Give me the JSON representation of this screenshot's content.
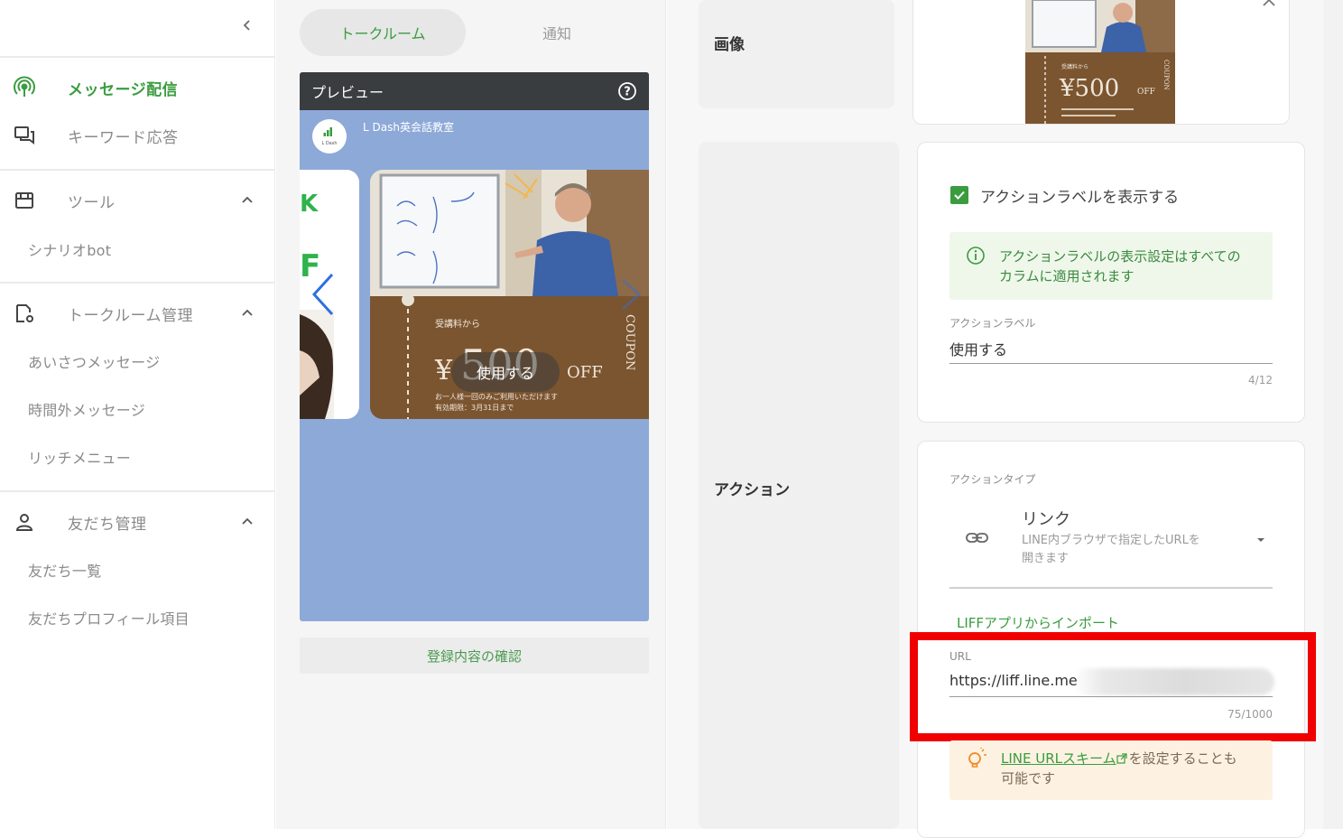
{
  "sidebar": {
    "collapse_icon": "chevron-left-icon",
    "items": [
      {
        "label": "メッセージ配信",
        "icon": "broadcast-icon",
        "active": true
      },
      {
        "label": "キーワード応答",
        "icon": "chat-reply-icon"
      }
    ],
    "tool_section": {
      "label": "ツール",
      "icon": "store-icon",
      "items": [
        "シナリオbot"
      ]
    },
    "talkroom_section": {
      "label": "トークルーム管理",
      "icon": "talkroom-settings-icon",
      "items": [
        "あいさつメッセージ",
        "時間外メッセージ",
        "リッチメニュー"
      ]
    },
    "friends_section": {
      "label": "友だち管理",
      "icon": "person-icon",
      "items": [
        "友だち一覧",
        "友だちプロフィール項目"
      ]
    }
  },
  "middle": {
    "tabs": [
      {
        "label": "トークルーム",
        "active": true
      },
      {
        "label": "通知",
        "active": false
      }
    ],
    "preview": {
      "title": "プレビュー",
      "bot_name": "L Dash英会話教室",
      "avatar_text": "L Dash",
      "left_card_letters": [
        "K",
        "F"
      ],
      "coupon": {
        "prefix": "受講料から",
        "currency": "¥",
        "amount": "500",
        "suffix": "OFF",
        "side_text": "COUPON",
        "note1": "お一人様一回のみご利用いただけます",
        "note2": "有効期限：3月31日まで"
      },
      "action_button": "使用する"
    },
    "confirm_button": "登録内容の確認"
  },
  "right": {
    "image_section": {
      "label": "画像",
      "thumbnail": {
        "prefix": "受講料から",
        "amount": "¥500",
        "suffix": "OFF",
        "side_text": "COUPON"
      }
    },
    "action_section": {
      "label": "アクション",
      "show_label_checkbox": "アクションラベルを表示する",
      "info_text_line1": "アクションラベルの表示設定はすべての",
      "info_text_line2": "カラムに適用されます",
      "action_label_caption": "アクションラベル",
      "action_label_value": "使用する",
      "action_label_counter": "4/12",
      "action_type_caption": "アクションタイプ",
      "action_type_value": "リンク",
      "action_type_desc_line1": "LINE内ブラウザで指定したURLを",
      "action_type_desc_line2": "開きます",
      "liff_import": "LIFFアプリからインポート",
      "url_caption": "URL",
      "url_value": "https://liff.line.me",
      "url_counter": "75/1000",
      "tip_link": "LINE URLスキーム",
      "tip_rest": "を設定することも",
      "tip_line2": "可能です"
    }
  },
  "colors": {
    "accent": "#3a9c3f",
    "highlight_frame": "#f00000",
    "preview_bg": "#8da9d8",
    "coupon_brown": "#7b5530"
  }
}
